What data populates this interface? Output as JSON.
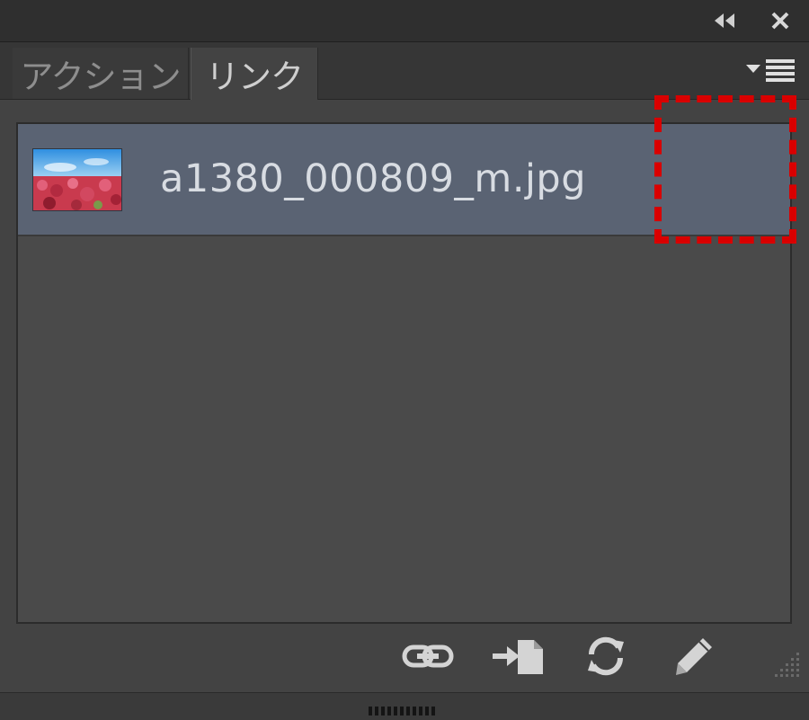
{
  "titlebar": {
    "collapse_icon": "double-chevron-left-icon",
    "close_icon": "close-icon"
  },
  "tabs": [
    {
      "label": "アクション",
      "active": false
    },
    {
      "label": "リンク",
      "active": true
    }
  ],
  "panel_menu_icon": "panel-menu-icon",
  "links": [
    {
      "filename": "a1380_000809_m.jpg",
      "selected": true,
      "thumbnail_icon": "image-thumbnail-icon"
    }
  ],
  "toolbar": {
    "buttons": [
      {
        "icon": "relink-icon"
      },
      {
        "icon": "go-to-link-icon"
      },
      {
        "icon": "update-link-icon"
      },
      {
        "icon": "edit-original-icon"
      }
    ]
  },
  "colors": {
    "panel_bg": "#434343",
    "selected_row": "#5a6373",
    "highlight_annotation": "#d90000",
    "text_primary": "#d8dce2"
  }
}
